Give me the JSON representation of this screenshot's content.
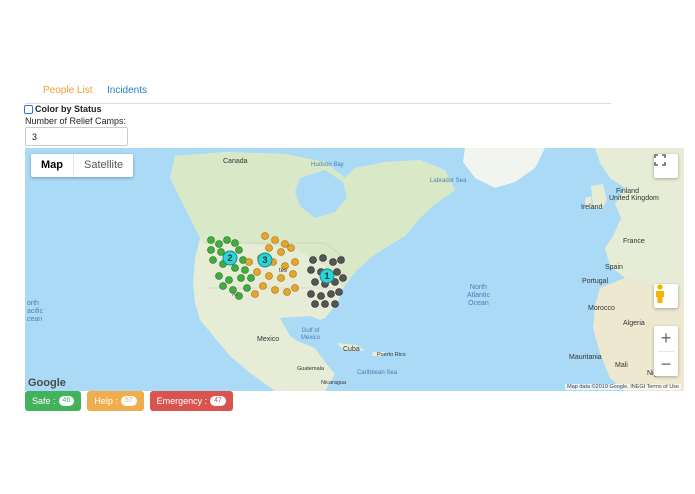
{
  "tabs": {
    "people": "People List",
    "incidents": "Incidents"
  },
  "options": {
    "color_by_status": "Color by Status",
    "camps_label": "Number of Relief Camps:",
    "camps_value": "3"
  },
  "map": {
    "map_type": {
      "map": "Map",
      "satellite": "Satellite"
    },
    "labels": {
      "canada": "Canada",
      "hudson_bay": "Hudson Bay",
      "labrador_sea": "Labrador Sea",
      "finland": "Finland",
      "ireland": "Ireland",
      "united_kingdom": "United Kingdom",
      "france": "France",
      "spain": "Spain",
      "portugal": "Portugal",
      "morocco": "Morocco",
      "algeria": "Algeria",
      "mauritania": "Mauritania",
      "mali": "Mali",
      "niger": "Niger",
      "mexico": "Mexico",
      "gulf_of_mexico": "Gulf of\nMexico",
      "cuba": "Cuba",
      "puerto_rico": "Puerto Rico",
      "caribbean_sea": "Caribbean Sea",
      "guatemala": "Guatemala",
      "nicaragua": "Nicaragua",
      "north_atlantic": "North\nAtlantic\nOcean",
      "north_pacific": "orth\nacific\ncean",
      "tes": "tes",
      "az": "AZ"
    },
    "clusters": [
      "2",
      "3",
      "1"
    ],
    "google": "Google",
    "attribution": "Map data ©2019 Google, INEGI  Terms of Use",
    "zoom_in": "+",
    "zoom_out": "−"
  },
  "status": {
    "safe_label": "Safe :",
    "safe_count": "46",
    "help_label": "Help :",
    "help_count": "57",
    "emergency_label": "Emergency :",
    "emergency_count": "47",
    "colors": {
      "safe": "#44b15c",
      "help": "#f0ad4e",
      "emergency": "#d9534f"
    }
  },
  "marker_colors": {
    "safe": "#3fae3f",
    "help": "#e8a628",
    "emergency": "#555555",
    "cluster": "#2ed3d3"
  }
}
